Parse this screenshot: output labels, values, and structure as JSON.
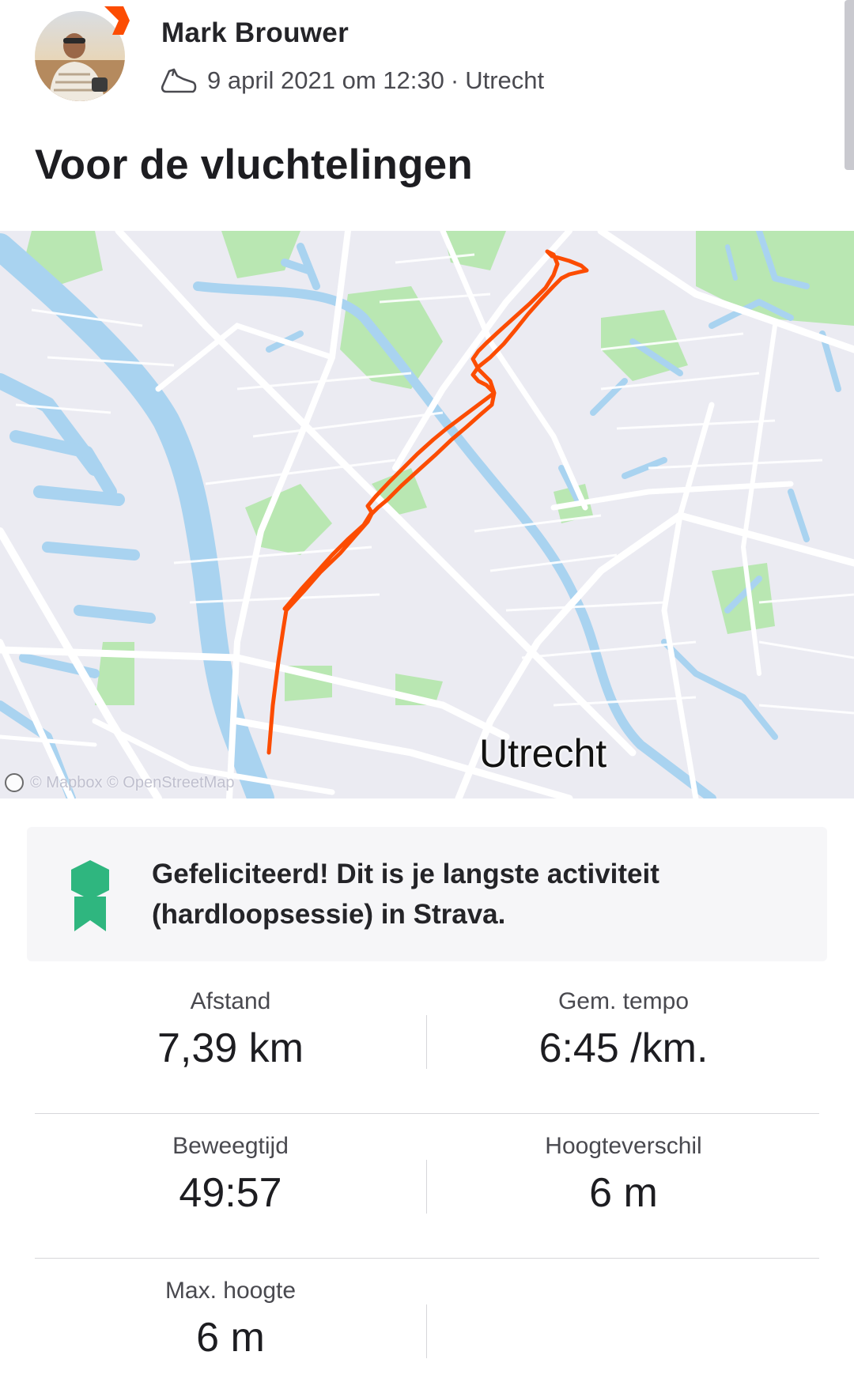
{
  "header": {
    "athlete_name": "Mark Brouwer",
    "date_time": "9 april 2021 om 12:30",
    "separator": "·",
    "location": "Utrecht",
    "activity_type_icon": "running-shoe-icon"
  },
  "activity": {
    "title": "Voor de vluchtelingen"
  },
  "map": {
    "city_label": "Utrecht",
    "attribution": "© Mapbox © OpenStreetMap",
    "route_color": "#fc4c02"
  },
  "achievement": {
    "icon": "medal-icon",
    "icon_color": "#2fb67f",
    "text": "Gefeliciteerd! Dit is je langste activiteit (hardloopsessie) in Strava."
  },
  "stats": [
    {
      "label": "Afstand",
      "value": "7,39 km"
    },
    {
      "label": "Gem. tempo",
      "value": "6:45 /km."
    },
    {
      "label": "Beweegtijd",
      "value": "49:57"
    },
    {
      "label": "Hoogteverschil",
      "value": "6 m"
    },
    {
      "label": "Max. hoogte",
      "value": "6 m"
    }
  ],
  "colors": {
    "brand_orange": "#fc4c02",
    "text_primary": "#242428",
    "map_water": "#a9d3f0",
    "map_park": "#b9e7b2"
  }
}
